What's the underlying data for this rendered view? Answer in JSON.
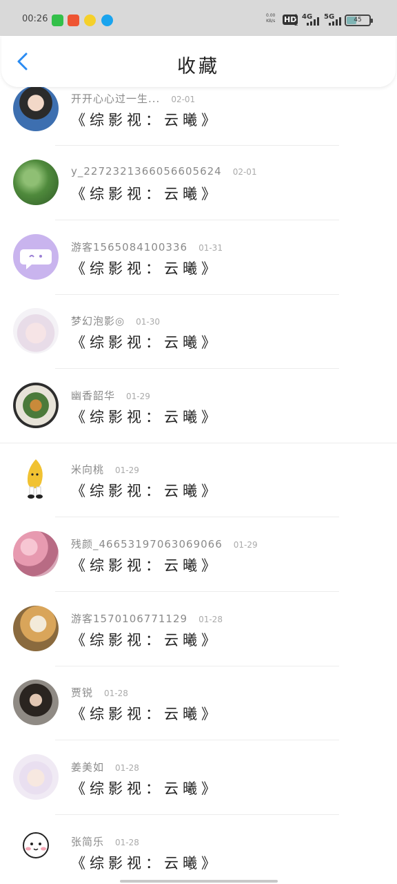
{
  "status_bar": {
    "time": "00:26",
    "net_speed_top": "0.00",
    "net_speed_bottom": "KB/s",
    "hd": "HD",
    "hd_sub": "1\n2",
    "sig1": "4G",
    "sig2": "5G",
    "battery": "45",
    "battery_level": 0.45
  },
  "header": {
    "title": "收藏"
  },
  "items": [
    {
      "name": "开开心心过一生...",
      "date": "02-01",
      "title": "《综影视：云曦》"
    },
    {
      "name": "y_2272321366056605624",
      "date": "02-01",
      "title": "《综影视：云曦》"
    },
    {
      "name": "游客1565084100336",
      "date": "01-31",
      "title": "《综影视：云曦》"
    },
    {
      "name": "梦幻泡影◎",
      "date": "01-30",
      "title": "《综影视：云曦》"
    },
    {
      "name": "幽香韶华",
      "date": "01-29",
      "title": "《综影视：云曦》"
    },
    {
      "name": "米向桃",
      "date": "01-29",
      "title": "《综影视：云曦》"
    },
    {
      "name": "残颜_46653197063069066",
      "date": "01-29",
      "title": "《综影视：云曦》"
    },
    {
      "name": "游客1570106771129",
      "date": "01-28",
      "title": "《综影视：云曦》"
    },
    {
      "name": "贾锐",
      "date": "01-28",
      "title": "《综影视：云曦》"
    },
    {
      "name": "姜美如",
      "date": "01-28",
      "title": "《综影视：云曦》"
    },
    {
      "name": "张简乐",
      "date": "01-28",
      "title": "《综影视：云曦》"
    }
  ],
  "colors": {
    "accent": "#2a8bf2",
    "status_bg": "#d9d9d9"
  }
}
